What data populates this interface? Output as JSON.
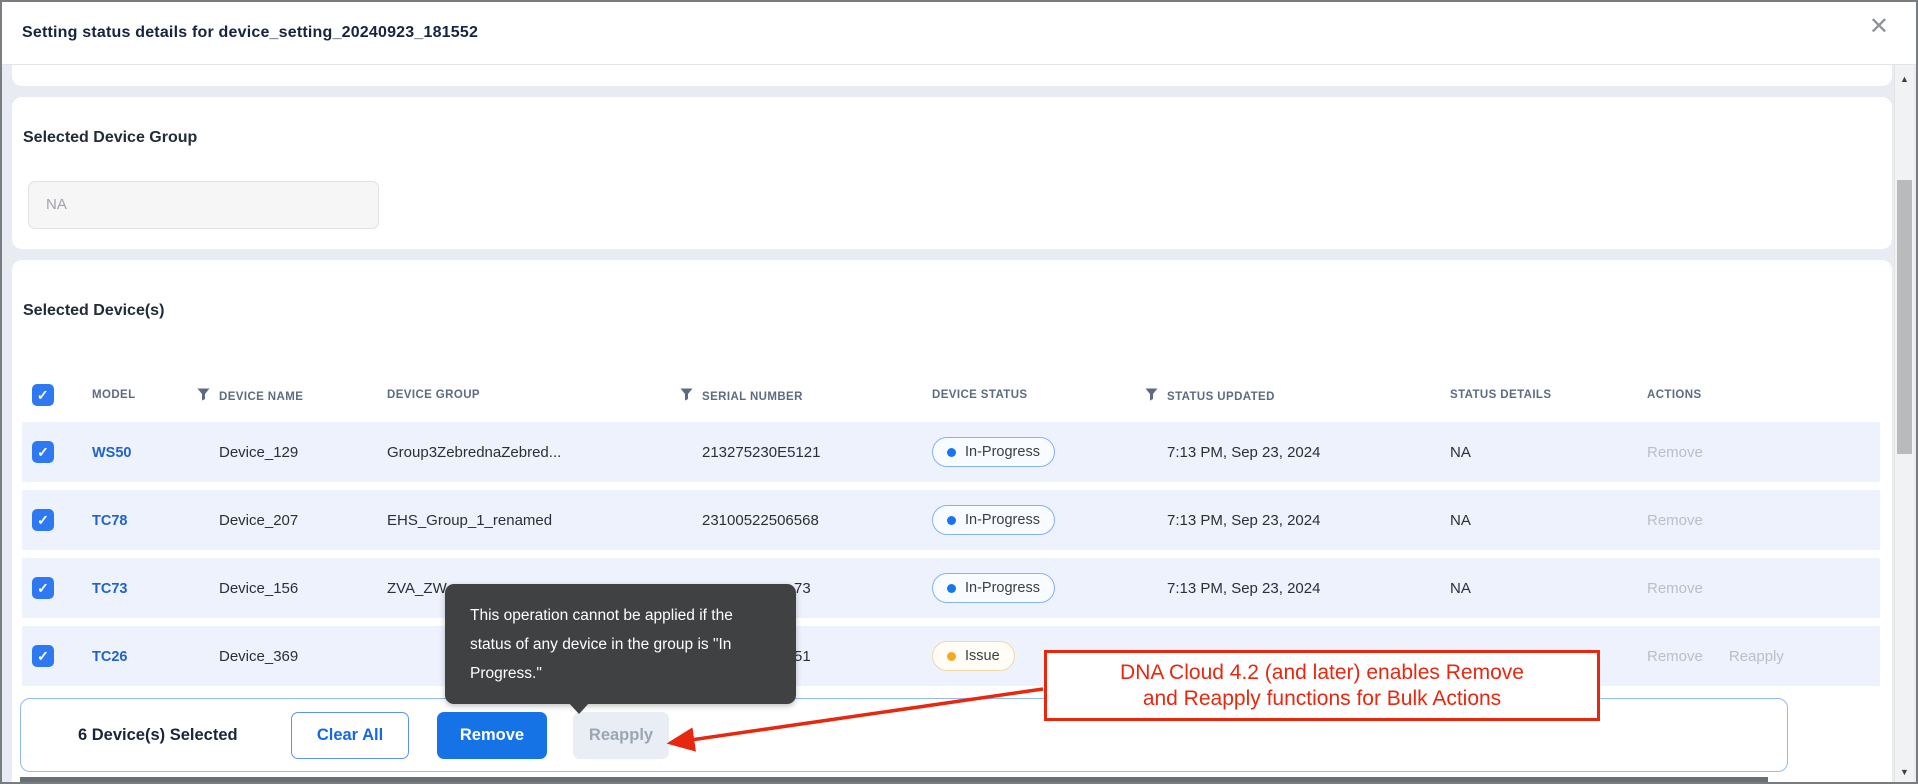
{
  "modal": {
    "title": "Setting status details for device_setting_20240923_181552"
  },
  "device_group_section": {
    "heading": "Selected Device Group",
    "group_field_value": "NA"
  },
  "devices_section": {
    "heading": "Selected Device(s)",
    "columns": [
      {
        "label": "MODEL",
        "filter": false
      },
      {
        "label": "DEVICE NAME",
        "filter": true
      },
      {
        "label": "DEVICE GROUP",
        "filter": false
      },
      {
        "label": "SERIAL NUMBER",
        "filter": true
      },
      {
        "label": "DEVICE STATUS",
        "filter": false
      },
      {
        "label": "STATUS UPDATED",
        "filter": true
      },
      {
        "label": "STATUS DETAILS",
        "filter": false
      },
      {
        "label": "ACTIONS",
        "filter": false
      }
    ],
    "rows": [
      {
        "checked": true,
        "model": "WS50",
        "device_name": "Device_129",
        "device_group": "Group3ZebrednaZebred...",
        "serial_number": "213275230E5121",
        "serial_truncated": false,
        "device_status": "In-Progress",
        "status_variant": "in-progress",
        "status_updated": "7:13 PM, Sep 23, 2024",
        "status_details": "NA",
        "actions": [
          "Remove"
        ]
      },
      {
        "checked": true,
        "model": "TC78",
        "device_name": "Device_207",
        "device_group": "EHS_Group_1_renamed",
        "serial_number": "23100522506568",
        "serial_truncated": false,
        "device_status": "In-Progress",
        "status_variant": "in-progress",
        "status_updated": "7:13 PM, Sep 23, 2024",
        "status_details": "NA",
        "actions": [
          "Remove"
        ]
      },
      {
        "checked": true,
        "model": "TC73",
        "device_name": "Device_156",
        "device_group": "ZVA_ZW",
        "serial_number": "73",
        "serial_truncated": true,
        "device_status": "In-Progress",
        "status_variant": "in-progress",
        "status_updated": "7:13 PM, Sep 23, 2024",
        "status_details": "NA",
        "actions": [
          "Remove"
        ]
      },
      {
        "checked": true,
        "model": "TC26",
        "device_name": "Device_369",
        "device_group": "",
        "serial_number": "51",
        "serial_truncated": true,
        "device_status": "Issue",
        "status_variant": "issue",
        "status_updated": "",
        "status_details": "",
        "actions": [
          "Remove",
          "Reapply"
        ]
      }
    ]
  },
  "status_colors": {
    "in_progress_dot": "#1676ee",
    "issue_dot": "#f7a821"
  },
  "footer": {
    "selected_count": "6 Device(s) Selected",
    "clear_all_label": "Clear All",
    "remove_label": "Remove",
    "reapply_label": "Reapply"
  },
  "tooltip": {
    "text": "This operation cannot be applied if the status of any device in the group is \"In Progress.\""
  },
  "annotation": {
    "line1": "DNA Cloud 4.2 (and later) enables Remove",
    "line2": "and Reapply functions for Bulk Actions",
    "color": "#e8270f"
  }
}
